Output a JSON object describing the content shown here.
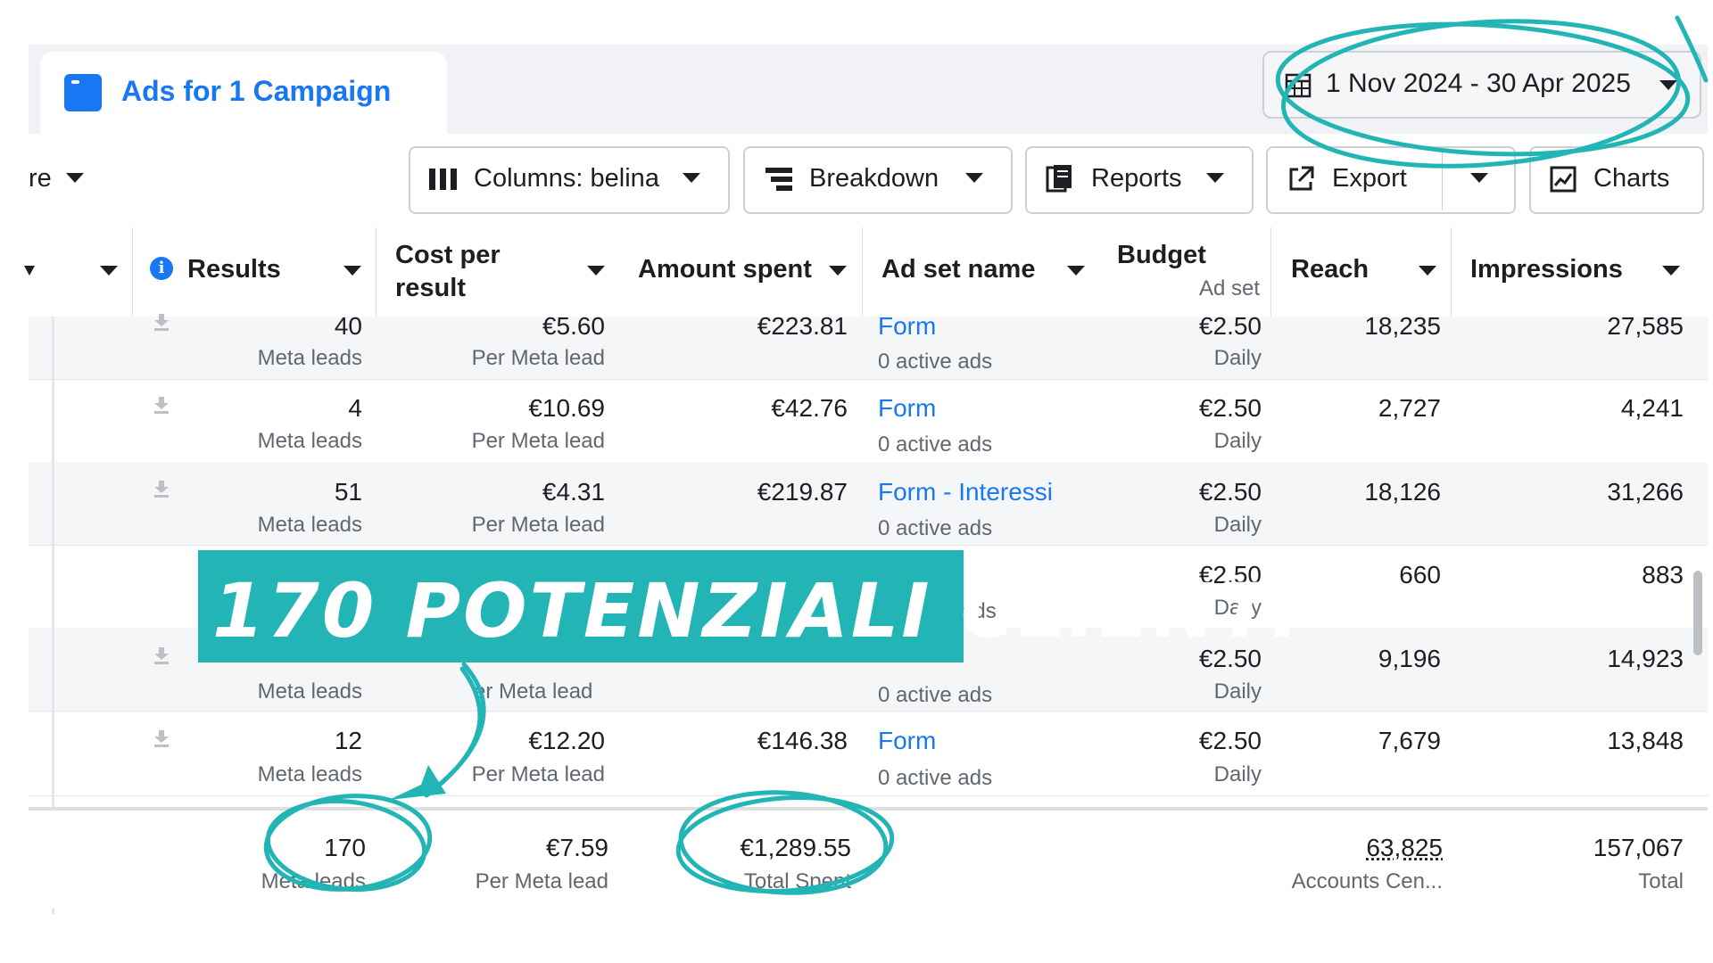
{
  "tab": {
    "label": "Ads for 1 Campaign"
  },
  "date_range": {
    "label": "1 Nov 2024 - 30 Apr 2025"
  },
  "toolbar": {
    "cut_label": "re",
    "columns_label": "Columns: belina",
    "breakdown_label": "Breakdown",
    "reports_label": "Reports",
    "export_label": "Export",
    "charts_label": "Charts"
  },
  "headers": {
    "results": "Results",
    "cost_line1": "Cost per",
    "cost_line2": "result",
    "amount": "Amount spent",
    "adset": "Ad set name",
    "budget": "Budget",
    "budget_sub": "Ad set",
    "reach": "Reach",
    "impressions": "Impressions"
  },
  "rows": [
    {
      "results": "40",
      "results_sub": "Meta leads",
      "cost": "€5.60",
      "cost_sub": "Per Meta lead",
      "amount": "€223.81",
      "adset": "Form",
      "adset_sub": "0 active ads",
      "budget": "€2.50",
      "budget_sub": "Daily",
      "reach": "18,235",
      "impressions": "27,585"
    },
    {
      "results": "4",
      "results_sub": "Meta leads",
      "cost": "€10.69",
      "cost_sub": "Per Meta lead",
      "amount": "€42.76",
      "adset": "Form",
      "adset_sub": "0 active ads",
      "budget": "€2.50",
      "budget_sub": "Daily",
      "reach": "2,727",
      "impressions": "4,241"
    },
    {
      "results": "51",
      "results_sub": "Meta leads",
      "cost": "€4.31",
      "cost_sub": "Per Meta lead",
      "amount": "€219.87",
      "adset": "Form - Interessi",
      "adset_sub": "0 active ads",
      "budget": "€2.50",
      "budget_sub": "Daily",
      "reach": "18,126",
      "impressions": "31,266"
    },
    {
      "adset_sub": "ads",
      "budget": "€2.50",
      "budget_sub": "Daily",
      "reach": "660",
      "impressions": "883"
    },
    {
      "results_sub": "Meta leads",
      "cost_sub": "er Meta lead",
      "adset_sub": "0 active ads",
      "budget": "€2.50",
      "budget_sub": "Daily",
      "reach": "9,196",
      "impressions": "14,923"
    },
    {
      "results": "12",
      "results_sub": "Meta leads",
      "cost": "€12.20",
      "cost_sub": "Per Meta lead",
      "amount": "€146.38",
      "adset": "Form",
      "adset_sub": "0 active ads",
      "budget": "€2.50",
      "budget_sub": "Daily",
      "reach": "7,679",
      "impressions": "13,848"
    }
  ],
  "totals": {
    "results": "170",
    "results_sub": "Meta leads",
    "cost": "€7.59",
    "cost_sub": "Per Meta lead",
    "amount": "€1,289.55",
    "amount_sub": "Total Spent",
    "reach": "63,825",
    "reach_sub": "Accounts Cen...",
    "impressions": "157,067",
    "impressions_sub": "Total"
  },
  "banner": {
    "text": "170 POTENZIALI CLIENTI"
  },
  "colors": {
    "accent": "#1877f2",
    "annotation": "#23b5b5"
  }
}
